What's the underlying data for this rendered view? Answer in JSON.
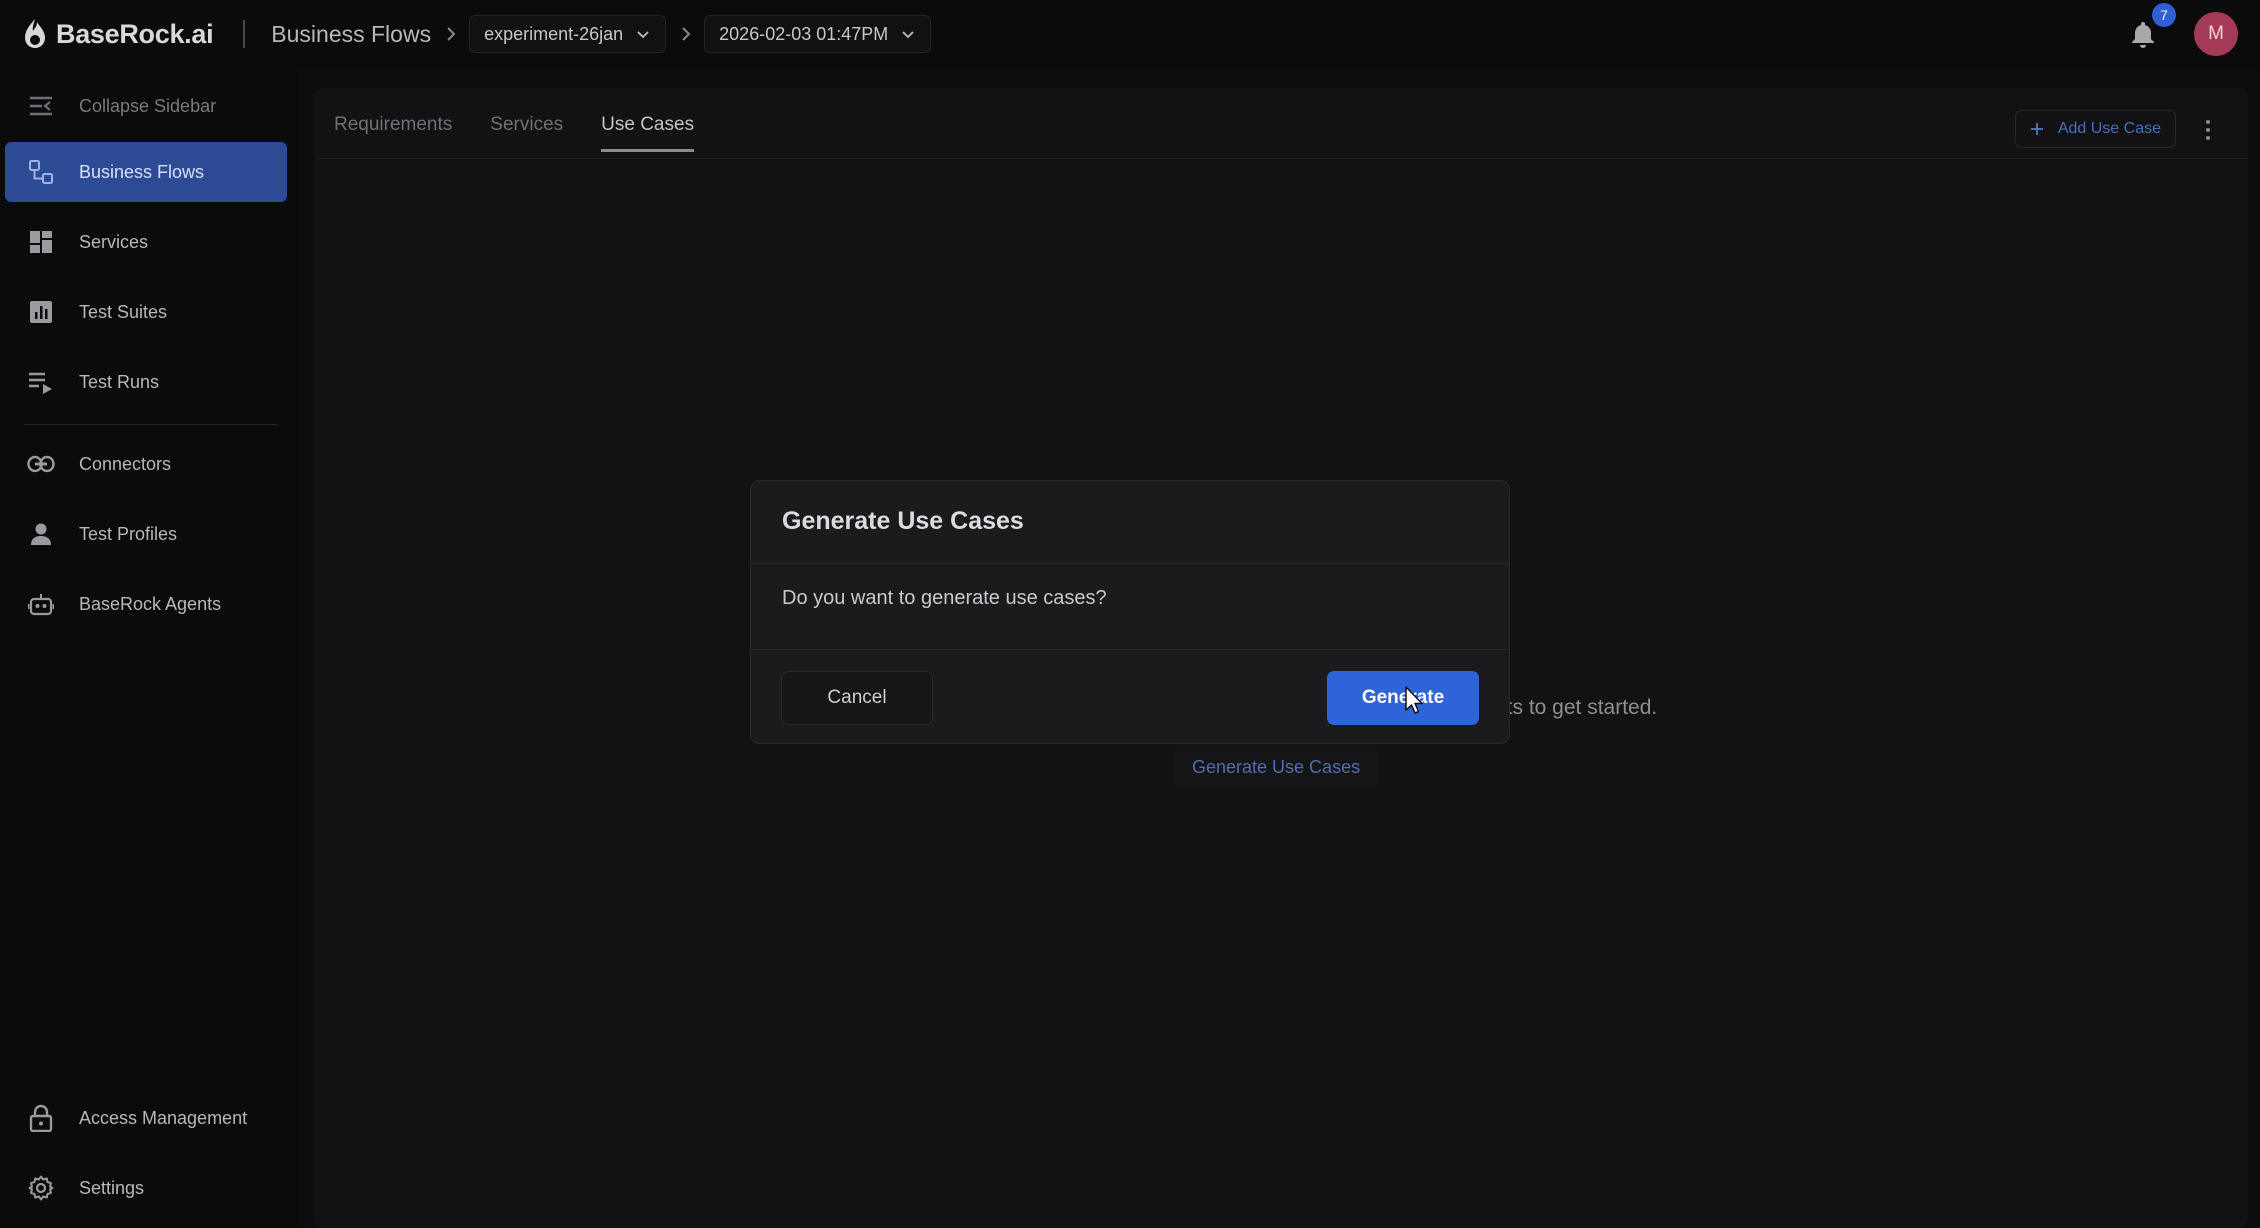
{
  "header": {
    "brand": "BaseRock.ai",
    "breadcrumb_title": "Business Flows",
    "project_select": "experiment-26jan",
    "run_select": "2026-02-03 01:47PM",
    "notification_count": "7",
    "avatar_initial": "M"
  },
  "sidebar": {
    "collapse_label": "Collapse Sidebar",
    "items": [
      {
        "label": "Business Flows",
        "icon": "flows-icon",
        "active": true
      },
      {
        "label": "Services",
        "icon": "grid-icon"
      },
      {
        "label": "Test Suites",
        "icon": "chart-icon"
      },
      {
        "label": "Test Runs",
        "icon": "list-play-icon"
      },
      {
        "label": "Connectors",
        "icon": "link-icon"
      },
      {
        "label": "Test Profiles",
        "icon": "person-icon"
      },
      {
        "label": "BaseRock Agents",
        "icon": "robot-icon"
      }
    ],
    "bottom_items": [
      {
        "label": "Access Management",
        "icon": "lock-icon"
      },
      {
        "label": "Settings",
        "icon": "gear-icon"
      }
    ]
  },
  "main": {
    "tabs": [
      {
        "label": "Requirements"
      },
      {
        "label": "Services"
      },
      {
        "label": "Use Cases",
        "active": true
      }
    ],
    "add_use_case_label": "Add Use Case",
    "empty_text": "its to get started.",
    "generate_link_label": "Generate Use Cases"
  },
  "modal": {
    "title": "Generate Use Cases",
    "body": "Do you want to generate use cases?",
    "cancel_label": "Cancel",
    "generate_label": "Generate"
  },
  "colors": {
    "accent": "#2f63d8",
    "sidebar_active": "#2c4b94",
    "avatar": "#a43a55"
  }
}
